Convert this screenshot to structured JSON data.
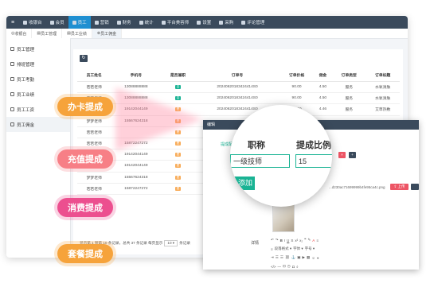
{
  "nav": {
    "items": [
      {
        "label": "收银台"
      },
      {
        "label": "会员"
      },
      {
        "label": "员工"
      },
      {
        "label": "营销"
      },
      {
        "label": "财务"
      },
      {
        "label": "统计"
      },
      {
        "label": "平台美容师"
      },
      {
        "label": "设置"
      },
      {
        "label": "采购"
      },
      {
        "label": "评论管理"
      }
    ]
  },
  "tabs": [
    "收银台",
    "员工管理",
    "员工业绩",
    "员工佣金"
  ],
  "sidebar": [
    "员工管理",
    "排班管理",
    "员工考勤",
    "员工业绩",
    "员工工资",
    "员工佣金"
  ],
  "table": {
    "headers": [
      "员工姓名",
      "手机号",
      "是否兼职",
      "订单号",
      "订单价格",
      "佣金",
      "订单类型",
      "订单标题"
    ],
    "rows": [
      {
        "name": "若若老师",
        "phone": "13088888888",
        "part": "否",
        "order": "20240620183424414S0",
        "price": "90.00",
        "commission": "4.50",
        "type": "服务",
        "title": "水氧清肤"
      },
      {
        "name": "若若老师",
        "phone": "13088888888",
        "part": "否",
        "order": "20240620183424414S0",
        "price": "90.00",
        "commission": "4.50",
        "type": "服务",
        "title": "水氧清肤"
      },
      {
        "name": "若若老师",
        "phone": "19142044149",
        "part": "是",
        "order": "20240620183424414S0",
        "price": "89.10",
        "commission": "4.46",
        "type": "服务",
        "title": "艾草热敷"
      },
      {
        "name": "梦梦老师",
        "phone": "15567624318",
        "part": "是",
        "order": "",
        "price": "",
        "commission": "",
        "type": "",
        "title": ""
      },
      {
        "name": "若若老师",
        "phone": "",
        "part": "是",
        "order": "",
        "price": "",
        "commission": "",
        "type": "",
        "title": ""
      },
      {
        "name": "若若老师",
        "phone": "15872247272",
        "part": "是",
        "order": "",
        "price": "",
        "commission": "",
        "type": "",
        "title": ""
      },
      {
        "name": "若若老师",
        "phone": "19142044149",
        "part": "是",
        "order": "",
        "price": "",
        "commission": "",
        "type": "",
        "title": ""
      },
      {
        "name": "静静老师",
        "phone": "19142044149",
        "part": "是",
        "order": "",
        "price": "",
        "commission": "",
        "type": "",
        "title": ""
      },
      {
        "name": "梦梦老师",
        "phone": "15567624318",
        "part": "是",
        "order": "",
        "price": "",
        "commission": "",
        "type": "",
        "title": ""
      },
      {
        "name": "若若老师",
        "phone": "15872247272",
        "part": "是",
        "order": "",
        "price": "",
        "commission": "",
        "type": "",
        "title": ""
      }
    ]
  },
  "pager": {
    "text": "显示第 1 到第 10 条记录，总共 37 条记录 每页显示",
    "size": "10",
    "suffix": "条记录"
  },
  "pills": [
    {
      "label": "办卡提成",
      "color": "#f6a33b"
    },
    {
      "label": "充值提成",
      "color": "#f77f86"
    },
    {
      "label": "消费提成",
      "color": "#ec4f8f"
    },
    {
      "label": "套餐提成",
      "color": "#f6a33b"
    }
  ],
  "modal": {
    "title": "编辑",
    "side_label": "提成配置",
    "col_name": "职称",
    "col_ratio": "提成比例",
    "name_value": "一级技师",
    "ratio_value": "15",
    "add_label": "添加",
    "file_name": "...d230ac71699999b4fe95ca4c.png",
    "upload_label": "上传",
    "detail_label": "详情",
    "font_label": "微软雅黑",
    "heading_label": "段落格式",
    "family_label": "字体",
    "size_label": "字号"
  },
  "colors": {
    "nav": "#3a4a5c",
    "active": "#1f8fd1",
    "green": "#1ab394",
    "orange": "#f8ac59"
  }
}
